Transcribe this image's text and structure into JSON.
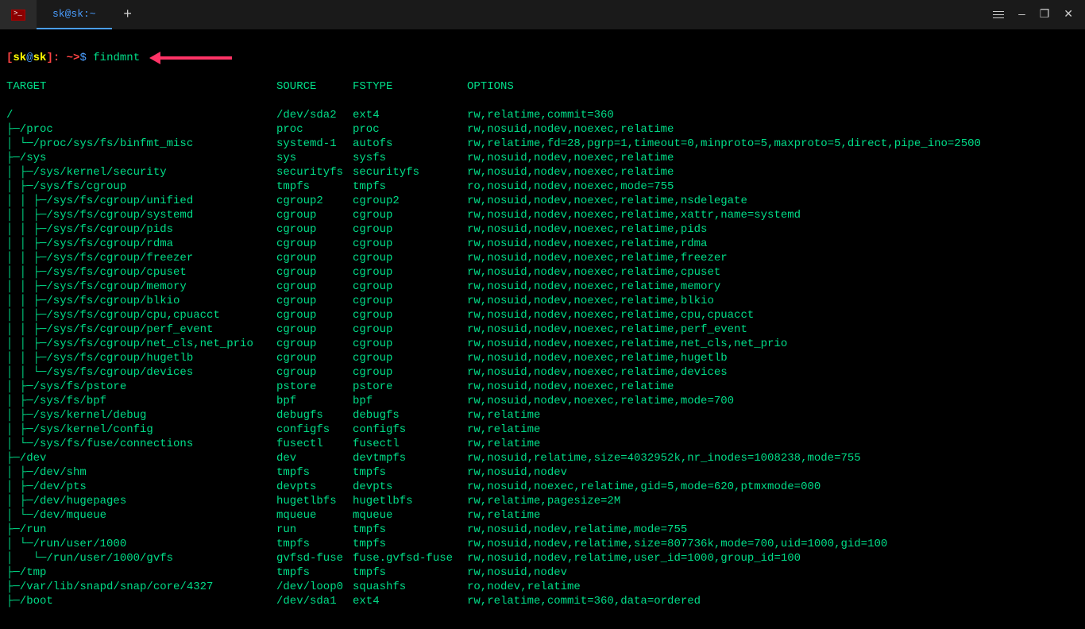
{
  "window": {
    "tab_title": "sk@sk:~",
    "new_tab": "+",
    "controls": {
      "min": "—",
      "max": "❐",
      "close": "✕"
    }
  },
  "prompt": {
    "lb": "[",
    "user": "sk",
    "at": "@",
    "host": "sk",
    "rb": "]",
    "colon": ":",
    "path": " ~>",
    "dollar": "$ ",
    "command": "findmnt"
  },
  "columns": {
    "target": "TARGET",
    "source": "SOURCE",
    "fstype": "FSTYPE",
    "options": "OPTIONS"
  },
  "rows": [
    {
      "t": "/",
      "s": "/dev/sda2",
      "f": "ext4",
      "o": "rw,relatime,commit=360"
    },
    {
      "t": "├─/proc",
      "s": "proc",
      "f": "proc",
      "o": "rw,nosuid,nodev,noexec,relatime"
    },
    {
      "t": "│ └─/proc/sys/fs/binfmt_misc",
      "s": "systemd-1",
      "f": "autofs",
      "o": "rw,relatime,fd=28,pgrp=1,timeout=0,minproto=5,maxproto=5,direct,pipe_ino=2500"
    },
    {
      "t": "├─/sys",
      "s": "sys",
      "f": "sysfs",
      "o": "rw,nosuid,nodev,noexec,relatime"
    },
    {
      "t": "│ ├─/sys/kernel/security",
      "s": "securityfs",
      "f": "securityfs",
      "o": "rw,nosuid,nodev,noexec,relatime"
    },
    {
      "t": "│ ├─/sys/fs/cgroup",
      "s": "tmpfs",
      "f": "tmpfs",
      "o": "ro,nosuid,nodev,noexec,mode=755"
    },
    {
      "t": "│ │ ├─/sys/fs/cgroup/unified",
      "s": "cgroup2",
      "f": "cgroup2",
      "o": "rw,nosuid,nodev,noexec,relatime,nsdelegate"
    },
    {
      "t": "│ │ ├─/sys/fs/cgroup/systemd",
      "s": "cgroup",
      "f": "cgroup",
      "o": "rw,nosuid,nodev,noexec,relatime,xattr,name=systemd"
    },
    {
      "t": "│ │ ├─/sys/fs/cgroup/pids",
      "s": "cgroup",
      "f": "cgroup",
      "o": "rw,nosuid,nodev,noexec,relatime,pids"
    },
    {
      "t": "│ │ ├─/sys/fs/cgroup/rdma",
      "s": "cgroup",
      "f": "cgroup",
      "o": "rw,nosuid,nodev,noexec,relatime,rdma"
    },
    {
      "t": "│ │ ├─/sys/fs/cgroup/freezer",
      "s": "cgroup",
      "f": "cgroup",
      "o": "rw,nosuid,nodev,noexec,relatime,freezer"
    },
    {
      "t": "│ │ ├─/sys/fs/cgroup/cpuset",
      "s": "cgroup",
      "f": "cgroup",
      "o": "rw,nosuid,nodev,noexec,relatime,cpuset"
    },
    {
      "t": "│ │ ├─/sys/fs/cgroup/memory",
      "s": "cgroup",
      "f": "cgroup",
      "o": "rw,nosuid,nodev,noexec,relatime,memory"
    },
    {
      "t": "│ │ ├─/sys/fs/cgroup/blkio",
      "s": "cgroup",
      "f": "cgroup",
      "o": "rw,nosuid,nodev,noexec,relatime,blkio"
    },
    {
      "t": "│ │ ├─/sys/fs/cgroup/cpu,cpuacct",
      "s": "cgroup",
      "f": "cgroup",
      "o": "rw,nosuid,nodev,noexec,relatime,cpu,cpuacct"
    },
    {
      "t": "│ │ ├─/sys/fs/cgroup/perf_event",
      "s": "cgroup",
      "f": "cgroup",
      "o": "rw,nosuid,nodev,noexec,relatime,perf_event"
    },
    {
      "t": "│ │ ├─/sys/fs/cgroup/net_cls,net_prio",
      "s": "cgroup",
      "f": "cgroup",
      "o": "rw,nosuid,nodev,noexec,relatime,net_cls,net_prio"
    },
    {
      "t": "│ │ ├─/sys/fs/cgroup/hugetlb",
      "s": "cgroup",
      "f": "cgroup",
      "o": "rw,nosuid,nodev,noexec,relatime,hugetlb"
    },
    {
      "t": "│ │ └─/sys/fs/cgroup/devices",
      "s": "cgroup",
      "f": "cgroup",
      "o": "rw,nosuid,nodev,noexec,relatime,devices"
    },
    {
      "t": "│ ├─/sys/fs/pstore",
      "s": "pstore",
      "f": "pstore",
      "o": "rw,nosuid,nodev,noexec,relatime"
    },
    {
      "t": "│ ├─/sys/fs/bpf",
      "s": "bpf",
      "f": "bpf",
      "o": "rw,nosuid,nodev,noexec,relatime,mode=700"
    },
    {
      "t": "│ ├─/sys/kernel/debug",
      "s": "debugfs",
      "f": "debugfs",
      "o": "rw,relatime"
    },
    {
      "t": "│ ├─/sys/kernel/config",
      "s": "configfs",
      "f": "configfs",
      "o": "rw,relatime"
    },
    {
      "t": "│ └─/sys/fs/fuse/connections",
      "s": "fusectl",
      "f": "fusectl",
      "o": "rw,relatime"
    },
    {
      "t": "├─/dev",
      "s": "dev",
      "f": "devtmpfs",
      "o": "rw,nosuid,relatime,size=4032952k,nr_inodes=1008238,mode=755"
    },
    {
      "t": "│ ├─/dev/shm",
      "s": "tmpfs",
      "f": "tmpfs",
      "o": "rw,nosuid,nodev"
    },
    {
      "t": "│ ├─/dev/pts",
      "s": "devpts",
      "f": "devpts",
      "o": "rw,nosuid,noexec,relatime,gid=5,mode=620,ptmxmode=000"
    },
    {
      "t": "│ ├─/dev/hugepages",
      "s": "hugetlbfs",
      "f": "hugetlbfs",
      "o": "rw,relatime,pagesize=2M"
    },
    {
      "t": "│ └─/dev/mqueue",
      "s": "mqueue",
      "f": "mqueue",
      "o": "rw,relatime"
    },
    {
      "t": "├─/run",
      "s": "run",
      "f": "tmpfs",
      "o": "rw,nosuid,nodev,relatime,mode=755"
    },
    {
      "t": "│ └─/run/user/1000",
      "s": "tmpfs",
      "f": "tmpfs",
      "o": "rw,nosuid,nodev,relatime,size=807736k,mode=700,uid=1000,gid=100"
    },
    {
      "t": "│   └─/run/user/1000/gvfs",
      "s": "gvfsd-fuse",
      "f": "fuse.gvfsd-fuse",
      "o": "rw,nosuid,nodev,relatime,user_id=1000,group_id=100"
    },
    {
      "t": "├─/tmp",
      "s": "tmpfs",
      "f": "tmpfs",
      "o": "rw,nosuid,nodev"
    },
    {
      "t": "├─/var/lib/snapd/snap/core/4327",
      "s": "/dev/loop0",
      "f": "squashfs",
      "o": "ro,nodev,relatime"
    },
    {
      "t": "├─/boot",
      "s": "/dev/sda1",
      "f": "ext4",
      "o": "rw,relatime,commit=360,data=ordered"
    }
  ]
}
